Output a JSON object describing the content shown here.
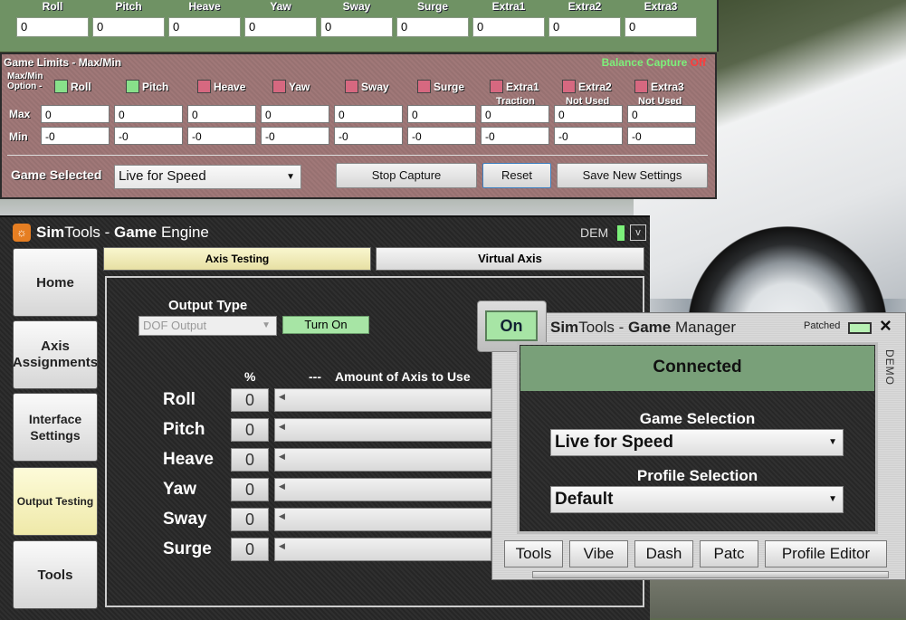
{
  "axis_strip": {
    "headers": [
      "Roll",
      "Pitch",
      "Heave",
      "Yaw",
      "Sway",
      "Surge",
      "Extra1",
      "Extra2",
      "Extra3"
    ],
    "values": [
      "0",
      "0",
      "0",
      "0",
      "0",
      "0",
      "0",
      "0",
      "0"
    ]
  },
  "limits": {
    "title": "Game Limits - Max/Min",
    "balance_text": "Balance Capture",
    "balance_state": "Off",
    "option_label": "Max/Min Option -",
    "options": [
      {
        "label": "Roll",
        "checked": true
      },
      {
        "label": "Pitch",
        "checked": true
      },
      {
        "label": "Heave",
        "checked": false
      },
      {
        "label": "Yaw",
        "checked": false
      },
      {
        "label": "Sway",
        "checked": false
      },
      {
        "label": "Surge",
        "checked": false
      },
      {
        "label": "Extra1",
        "checked": false
      },
      {
        "label": "Extra2",
        "checked": false
      },
      {
        "label": "Extra3",
        "checked": false
      }
    ],
    "sub_labels": [
      "Traction",
      "Not Used",
      "Not Used"
    ],
    "max_label": "Max",
    "min_label": "Min",
    "max_values": [
      "0",
      "0",
      "0",
      "0",
      "0",
      "0",
      "0",
      "0",
      "0"
    ],
    "min_values": [
      "-0",
      "-0",
      "-0",
      "-0",
      "-0",
      "-0",
      "-0",
      "-0",
      "-0"
    ],
    "game_selected_label": "Game Selected",
    "game_selected_value": "Live for Speed",
    "stop_capture": "Stop Capture",
    "reset": "Reset",
    "save_settings": "Save New Settings"
  },
  "engine": {
    "title_prefix": "Sim",
    "title_mid": "Tools - ",
    "title_bold": "Game",
    "title_suffix": " Engine",
    "demo_tag": "DEM",
    "nav": [
      "Home",
      "Axis Assignments",
      "Interface Settings",
      "Output Testing",
      "Tools"
    ],
    "tabs": [
      "Axis Testing",
      "Virtual Axis"
    ],
    "output_type_label": "Output Type",
    "output_type_value": "DOF Output",
    "turn_on": "Turn On",
    "percent_header": "%",
    "amount_header": "---    Amount of Axis to Use",
    "axes": [
      {
        "name": "Roll",
        "value": "0"
      },
      {
        "name": "Pitch",
        "value": "0"
      },
      {
        "name": "Heave",
        "value": "0"
      },
      {
        "name": "Yaw",
        "value": "0"
      },
      {
        "name": "Sway",
        "value": "0"
      },
      {
        "name": "Surge",
        "value": "0"
      }
    ]
  },
  "manager": {
    "on_label": "On",
    "title_prefix": "Sim",
    "title_mid": "Tools - ",
    "title_bold": "Game",
    "title_suffix": " Manager",
    "patched": "Patched",
    "close": "×",
    "demo_vertical": "DEMO",
    "status": "Connected",
    "game_selection_label": "Game Selection",
    "game_selection_value": "Live for Speed",
    "profile_selection_label": "Profile Selection",
    "profile_selection_value": "Default",
    "tools": [
      "Tools",
      "Vibe",
      "Dash",
      "Patc",
      "Profile Editor"
    ]
  },
  "colors": {
    "balance_green": "#7cf07a",
    "balance_off": "#ff3b3b",
    "status_green": "#79a079"
  }
}
